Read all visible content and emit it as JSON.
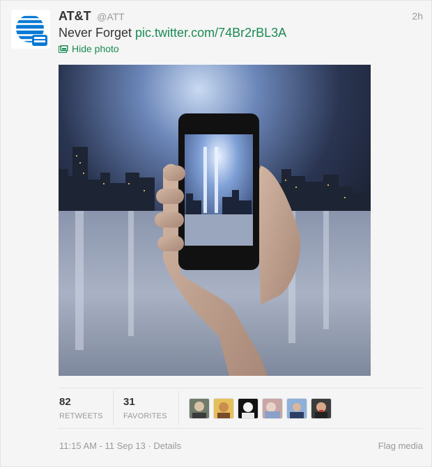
{
  "account": {
    "name": "AT&T",
    "handle": "@ATT",
    "avatar_icon": "att-globe-logo"
  },
  "tweet": {
    "timestamp_relative": "2h",
    "text_prefix": "Never Forget ",
    "link": "pic.twitter.com/74Br2rBL3A",
    "hide_photo_label": "Hide photo",
    "photo_description_icon": "phone-in-hand-photo"
  },
  "stats": {
    "retweets_count": "82",
    "retweets_label": "RETWEETS",
    "favorites_count": "31",
    "favorites_label": "FAVORITES"
  },
  "footer": {
    "datetime": "11:15 AM - 11 Sep 13",
    "separator": " · ",
    "details_label": "Details",
    "flag_label": "Flag media"
  },
  "colors": {
    "link": "#1b8a53",
    "muted": "#999999",
    "text": "#333333",
    "brand_blue": "#0a7ad5"
  }
}
